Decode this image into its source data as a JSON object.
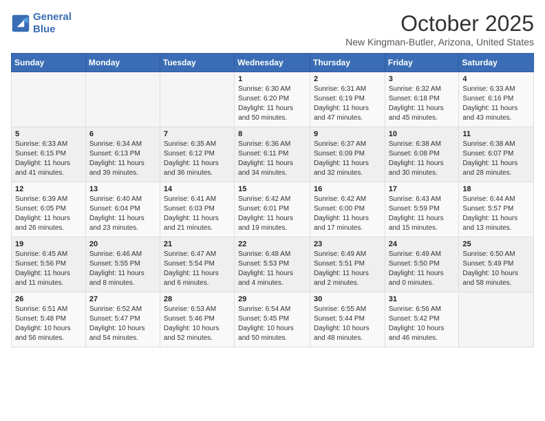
{
  "logo": {
    "line1": "General",
    "line2": "Blue"
  },
  "title": "October 2025",
  "location": "New Kingman-Butler, Arizona, United States",
  "headers": [
    "Sunday",
    "Monday",
    "Tuesday",
    "Wednesday",
    "Thursday",
    "Friday",
    "Saturday"
  ],
  "rows": [
    [
      {
        "day": "",
        "info": ""
      },
      {
        "day": "",
        "info": ""
      },
      {
        "day": "",
        "info": ""
      },
      {
        "day": "1",
        "info": "Sunrise: 6:30 AM\nSunset: 6:20 PM\nDaylight: 11 hours\nand 50 minutes."
      },
      {
        "day": "2",
        "info": "Sunrise: 6:31 AM\nSunset: 6:19 PM\nDaylight: 11 hours\nand 47 minutes."
      },
      {
        "day": "3",
        "info": "Sunrise: 6:32 AM\nSunset: 6:18 PM\nDaylight: 11 hours\nand 45 minutes."
      },
      {
        "day": "4",
        "info": "Sunrise: 6:33 AM\nSunset: 6:16 PM\nDaylight: 11 hours\nand 43 minutes."
      }
    ],
    [
      {
        "day": "5",
        "info": "Sunrise: 6:33 AM\nSunset: 6:15 PM\nDaylight: 11 hours\nand 41 minutes."
      },
      {
        "day": "6",
        "info": "Sunrise: 6:34 AM\nSunset: 6:13 PM\nDaylight: 11 hours\nand 39 minutes."
      },
      {
        "day": "7",
        "info": "Sunrise: 6:35 AM\nSunset: 6:12 PM\nDaylight: 11 hours\nand 36 minutes."
      },
      {
        "day": "8",
        "info": "Sunrise: 6:36 AM\nSunset: 6:11 PM\nDaylight: 11 hours\nand 34 minutes."
      },
      {
        "day": "9",
        "info": "Sunrise: 6:37 AM\nSunset: 6:09 PM\nDaylight: 11 hours\nand 32 minutes."
      },
      {
        "day": "10",
        "info": "Sunrise: 6:38 AM\nSunset: 6:08 PM\nDaylight: 11 hours\nand 30 minutes."
      },
      {
        "day": "11",
        "info": "Sunrise: 6:38 AM\nSunset: 6:07 PM\nDaylight: 11 hours\nand 28 minutes."
      }
    ],
    [
      {
        "day": "12",
        "info": "Sunrise: 6:39 AM\nSunset: 6:05 PM\nDaylight: 11 hours\nand 26 minutes."
      },
      {
        "day": "13",
        "info": "Sunrise: 6:40 AM\nSunset: 6:04 PM\nDaylight: 11 hours\nand 23 minutes."
      },
      {
        "day": "14",
        "info": "Sunrise: 6:41 AM\nSunset: 6:03 PM\nDaylight: 11 hours\nand 21 minutes."
      },
      {
        "day": "15",
        "info": "Sunrise: 6:42 AM\nSunset: 6:01 PM\nDaylight: 11 hours\nand 19 minutes."
      },
      {
        "day": "16",
        "info": "Sunrise: 6:42 AM\nSunset: 6:00 PM\nDaylight: 11 hours\nand 17 minutes."
      },
      {
        "day": "17",
        "info": "Sunrise: 6:43 AM\nSunset: 5:59 PM\nDaylight: 11 hours\nand 15 minutes."
      },
      {
        "day": "18",
        "info": "Sunrise: 6:44 AM\nSunset: 5:57 PM\nDaylight: 11 hours\nand 13 minutes."
      }
    ],
    [
      {
        "day": "19",
        "info": "Sunrise: 6:45 AM\nSunset: 5:56 PM\nDaylight: 11 hours\nand 11 minutes."
      },
      {
        "day": "20",
        "info": "Sunrise: 6:46 AM\nSunset: 5:55 PM\nDaylight: 11 hours\nand 8 minutes."
      },
      {
        "day": "21",
        "info": "Sunrise: 6:47 AM\nSunset: 5:54 PM\nDaylight: 11 hours\nand 6 minutes."
      },
      {
        "day": "22",
        "info": "Sunrise: 6:48 AM\nSunset: 5:53 PM\nDaylight: 11 hours\nand 4 minutes."
      },
      {
        "day": "23",
        "info": "Sunrise: 6:49 AM\nSunset: 5:51 PM\nDaylight: 11 hours\nand 2 minutes."
      },
      {
        "day": "24",
        "info": "Sunrise: 6:49 AM\nSunset: 5:50 PM\nDaylight: 11 hours\nand 0 minutes."
      },
      {
        "day": "25",
        "info": "Sunrise: 6:50 AM\nSunset: 5:49 PM\nDaylight: 10 hours\nand 58 minutes."
      }
    ],
    [
      {
        "day": "26",
        "info": "Sunrise: 6:51 AM\nSunset: 5:48 PM\nDaylight: 10 hours\nand 56 minutes."
      },
      {
        "day": "27",
        "info": "Sunrise: 6:52 AM\nSunset: 5:47 PM\nDaylight: 10 hours\nand 54 minutes."
      },
      {
        "day": "28",
        "info": "Sunrise: 6:53 AM\nSunset: 5:46 PM\nDaylight: 10 hours\nand 52 minutes."
      },
      {
        "day": "29",
        "info": "Sunrise: 6:54 AM\nSunset: 5:45 PM\nDaylight: 10 hours\nand 50 minutes."
      },
      {
        "day": "30",
        "info": "Sunrise: 6:55 AM\nSunset: 5:44 PM\nDaylight: 10 hours\nand 48 minutes."
      },
      {
        "day": "31",
        "info": "Sunrise: 6:56 AM\nSunset: 5:42 PM\nDaylight: 10 hours\nand 46 minutes."
      },
      {
        "day": "",
        "info": ""
      }
    ]
  ]
}
